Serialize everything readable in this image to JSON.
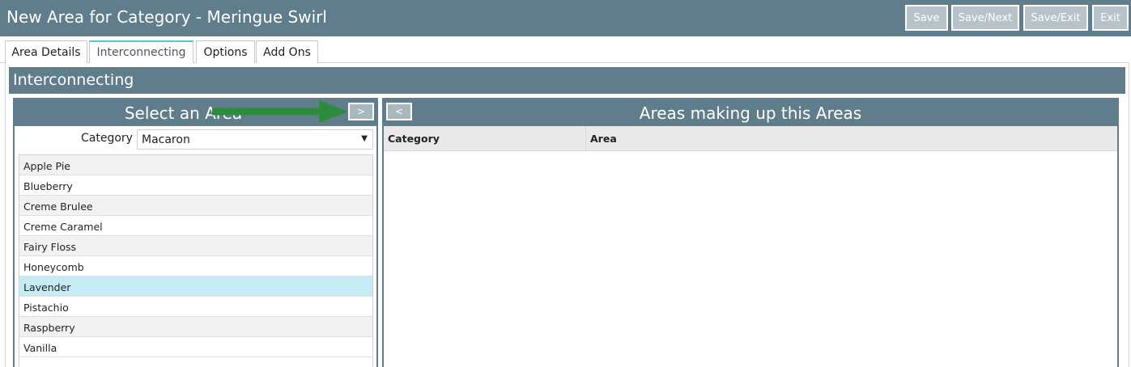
{
  "header": {
    "title": "New Area for Category - Meringue Swirl",
    "buttons": {
      "save": "Save",
      "save_next": "Save/Next",
      "save_exit": "Save/Exit",
      "exit": "Exit"
    }
  },
  "tabs": [
    {
      "label": "Area Details",
      "active": false
    },
    {
      "label": "Interconnecting",
      "active": true
    },
    {
      "label": "Options",
      "active": false
    },
    {
      "label": "Add Ons",
      "active": false
    }
  ],
  "section": {
    "title": "Interconnecting"
  },
  "left_panel": {
    "title": "Select an Area",
    "move_right_label": ">",
    "category_label": "Category",
    "category_value": "Macaron",
    "items": [
      "Apple Pie",
      "Blueberry",
      "Creme Brulee",
      "Creme Caramel",
      "Fairy Floss",
      "Honeycomb",
      "Lavender",
      "Pistachio",
      "Raspberry",
      "Vanilla"
    ],
    "selected_item": "Lavender"
  },
  "right_panel": {
    "title": "Areas making up this Areas",
    "move_left_label": "<",
    "columns": [
      "Category",
      "Area"
    ]
  },
  "colors": {
    "header_bg": "#607d8b",
    "selected_row": "#c5ebf4",
    "annotation_arrow": "#2e8b3d",
    "active_tab_accent": "#5bc0de"
  },
  "icons": {
    "annotation": "arrow-right-icon",
    "dropdown": "chevron-down-icon"
  }
}
